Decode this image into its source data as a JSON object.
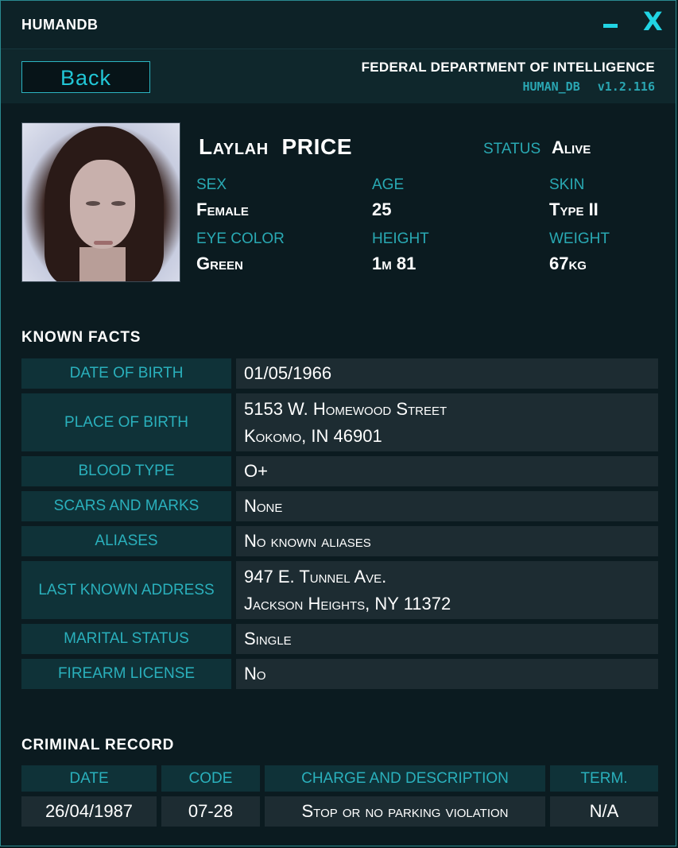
{
  "window": {
    "title": "HUMANDB",
    "minimize_glyph": "minimize-icon",
    "close_glyph": "X"
  },
  "header": {
    "back_label": "Back",
    "agency": "FEDERAL DEPARTMENT OF INTELLIGENCE",
    "db_name": "HUMAN_DB",
    "version": "v1.2.116"
  },
  "profile": {
    "first_name": "Laylah",
    "last_name": "PRICE",
    "status_label": "STATUS",
    "status_value": "Alive",
    "attributes": [
      {
        "label": "SEX",
        "value": "Female"
      },
      {
        "label": "AGE",
        "value": "25"
      },
      {
        "label": "SKIN",
        "value": "Type II"
      },
      {
        "label": "EYE COLOR",
        "value": "Green"
      },
      {
        "label": "HEIGHT",
        "value": "1m 81"
      },
      {
        "label": "WEIGHT",
        "value": "67kg"
      }
    ]
  },
  "known_facts": {
    "title": "KNOWN  FACTS",
    "rows": [
      {
        "key": "DATE OF BIRTH",
        "lines": [
          "01/05/1966"
        ]
      },
      {
        "key": "PLACE OF BIRTH",
        "lines": [
          "5153 W. Homewood Street",
          "Kokomo, IN 46901"
        ]
      },
      {
        "key": "BLOOD TYPE",
        "lines": [
          "O+"
        ]
      },
      {
        "key": "SCARS AND MARKS",
        "lines": [
          "None"
        ]
      },
      {
        "key": "ALIASES",
        "lines": [
          "No known aliases"
        ]
      },
      {
        "key": "LAST KNOWN ADDRESS",
        "lines": [
          "947 E. Tunnel Ave.",
          "Jackson Heights, NY 11372"
        ]
      },
      {
        "key": "MARITAL STATUS",
        "lines": [
          "Single"
        ]
      },
      {
        "key": "FIREARM LICENSE",
        "lines": [
          "No"
        ]
      }
    ]
  },
  "criminal_record": {
    "title": "CRIMINAL  RECORD",
    "columns": [
      "DATE",
      "CODE",
      "CHARGE AND DESCRIPTION",
      "TERM."
    ],
    "rows": [
      [
        "26/04/1987",
        "07-28",
        "Stop or no parking violation",
        "N/A"
      ]
    ]
  },
  "colors": {
    "accent": "#21d4e4",
    "label": "#29a9b3",
    "key_bg": "#0f3238",
    "value_bg": "#1d2c32",
    "background": "#0b1b20"
  }
}
